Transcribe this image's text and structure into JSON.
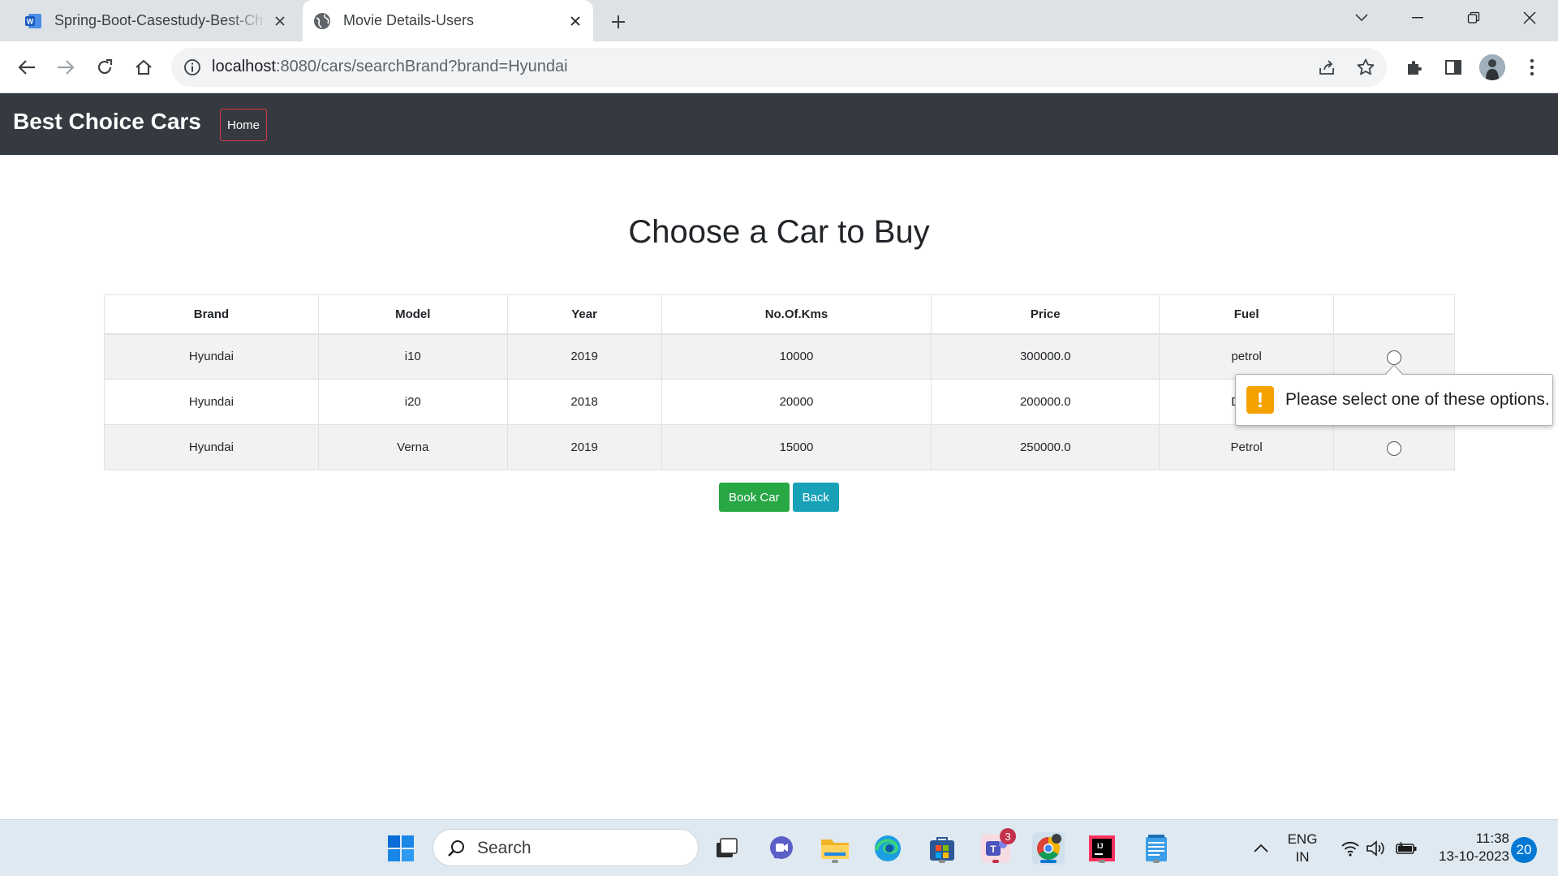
{
  "browser": {
    "tabs": [
      {
        "title": "Spring-Boot-Casestudy-Best-Ch",
        "favicon": "word-icon",
        "active": false
      },
      {
        "title": "Movie Details-Users",
        "favicon": "globe-icon",
        "active": true
      }
    ],
    "address": {
      "host": "localhost",
      "rest": ":8080/cars/searchBrand?brand=Hyundai"
    }
  },
  "navbar": {
    "brand": "Best Choice Cars",
    "home_label": "Home"
  },
  "page": {
    "title": "Choose a Car to Buy"
  },
  "table": {
    "headers": [
      "Brand",
      "Model",
      "Year",
      "No.Of.Kms",
      "Price",
      "Fuel",
      ""
    ],
    "rows": [
      [
        "Hyundai",
        "i10",
        "2019",
        "10000",
        "300000.0",
        "petrol"
      ],
      [
        "Hyundai",
        "i20",
        "2018",
        "20000",
        "200000.0",
        "D"
      ],
      [
        "Hyundai",
        "Verna",
        "2019",
        "15000",
        "250000.0",
        "Petrol"
      ]
    ]
  },
  "buttons": {
    "book": "Book Car",
    "back": "Back"
  },
  "validation": {
    "message": "Please select one of these options.",
    "icon": "!"
  },
  "taskbar": {
    "search_placeholder": "Search",
    "teams_badge": "3",
    "language": "ENG",
    "region": "IN",
    "time": "11:38",
    "date": "13-10-2023",
    "notifications": "20"
  },
  "colors": {
    "navbar": "#343a40",
    "home_border": "#dc3545",
    "book": "#28a745",
    "back": "#17a2b8",
    "tooltip_icon": "#f5a100"
  }
}
